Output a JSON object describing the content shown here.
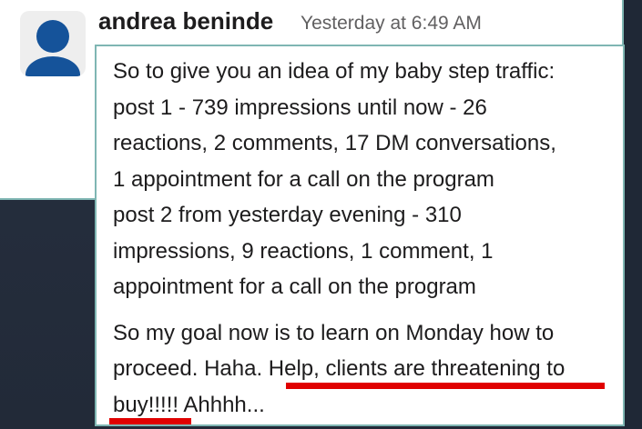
{
  "message": {
    "author": "andrea beninde",
    "timestamp": "Yesterday at 6:49 AM",
    "paragraph1": [
      "So to give you an idea of my baby step traffic:",
      "post 1 - 739 impressions until now - 26",
      "reactions, 2 comments, 17 DM conversations,",
      "1 appointment for a call on the program",
      "post 2 from yesterday evening - 310",
      "impressions, 9 reactions, 1 comment, 1",
      "appointment for a call on the program"
    ],
    "paragraph2": [
      "So my goal now is to learn on Monday how to",
      "proceed. Haha. Help, clients are threatening to",
      "buy!!!!! Ahhhh..."
    ],
    "highlighted_text": "Help, clients are threatening to buy!!!!!"
  },
  "colors": {
    "avatar": "#15539a",
    "border": "#7fb6b3",
    "underline": "#e00000",
    "background_dark": "#263040"
  }
}
